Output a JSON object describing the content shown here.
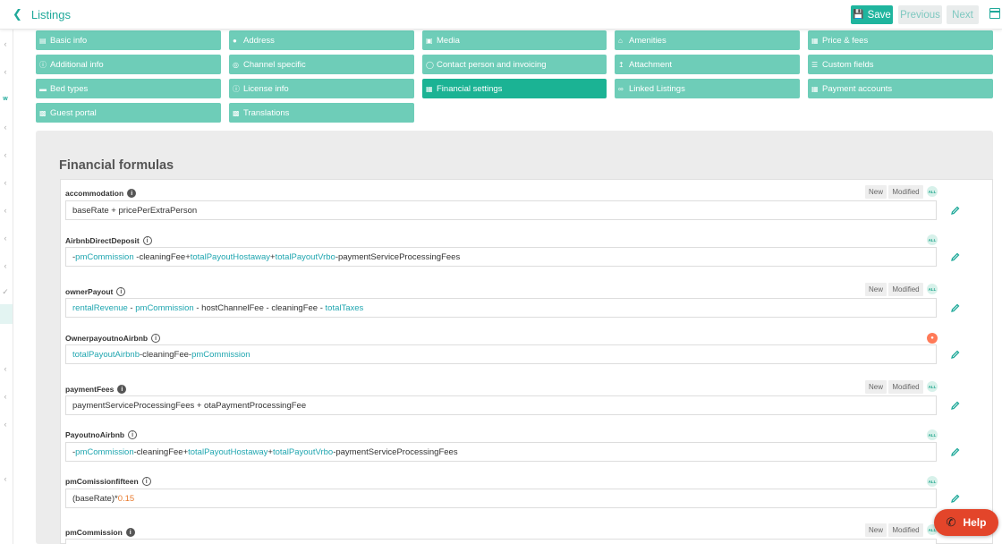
{
  "header": {
    "back_label": "Listings",
    "save_label": "Save",
    "previous_label": "Previous",
    "next_label": "Next"
  },
  "sidebar": {
    "items": [
      "‹",
      "‹",
      "w",
      "‹",
      "‹",
      "‹",
      "‹",
      "‹",
      "‹",
      "✓",
      "‹",
      "‹",
      "‹",
      "‹"
    ]
  },
  "tabs": [
    {
      "label": "Basic info",
      "icon": "id-card-icon"
    },
    {
      "label": "Address",
      "icon": "map-marker-icon"
    },
    {
      "label": "Media",
      "icon": "camera-icon"
    },
    {
      "label": "Amenities",
      "icon": "home-icon"
    },
    {
      "label": "Price & fees",
      "icon": "money-icon"
    },
    {
      "label": "Additional info",
      "icon": "info-circle-icon"
    },
    {
      "label": "Channel specific",
      "icon": "globe-icon"
    },
    {
      "label": "Contact person and invoicing",
      "icon": "user-icon"
    },
    {
      "label": "Attachment",
      "icon": "upload-icon"
    },
    {
      "label": "Custom fields",
      "icon": "list-icon"
    },
    {
      "label": "Bed types",
      "icon": "bed-icon"
    },
    {
      "label": "License info",
      "icon": "info-circle-icon"
    },
    {
      "label": "Financial settings",
      "icon": "money-icon",
      "active": true
    },
    {
      "label": "Linked Listings",
      "icon": "link-icon"
    },
    {
      "label": "Payment accounts",
      "icon": "money-icon"
    },
    {
      "label": "Guest portal",
      "icon": "briefcase-icon"
    },
    {
      "label": "Translations",
      "icon": "language-icon"
    }
  ],
  "section": {
    "title": "Financial formulas"
  },
  "formulas": [
    {
      "name": "accommodation",
      "tags": [
        "New",
        "Modified"
      ],
      "badge": "ALL"
    },
    {
      "name": "AirbnbDirectDeposit",
      "tags": [],
      "badge": "ALL"
    },
    {
      "name": "ownerPayout",
      "tags": [
        "New",
        "Modified"
      ],
      "badge": "ALL"
    },
    {
      "name": "OwnerpayoutnoAirbnb",
      "tags": [],
      "badge": "airbnb"
    },
    {
      "name": "paymentFees",
      "tags": [
        "New",
        "Modified"
      ],
      "badge": "ALL"
    },
    {
      "name": "PayoutnoAirbnb",
      "tags": [],
      "badge": "ALL"
    },
    {
      "name": "pmComissionfifteen",
      "tags": [],
      "badge": "ALL"
    },
    {
      "name": "pmCommission",
      "tags": [
        "New",
        "Modified"
      ],
      "badge": "ALL"
    }
  ],
  "badge_all_label": "ALL",
  "tag_new_label": "New",
  "tag_modified_label": "Modified",
  "help_label": "Help",
  "colors": {
    "accent": "#1fb59e",
    "tab": "#6ecdb8",
    "tab_active": "#1bb394",
    "variable": "#20a6b0",
    "number": "#e87b2e",
    "help": "#e3452a"
  }
}
